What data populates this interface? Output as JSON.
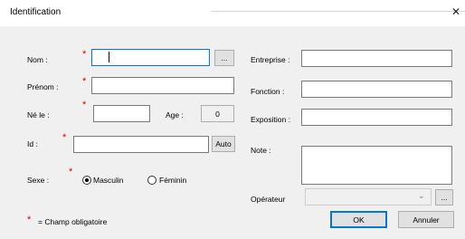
{
  "window": {
    "title": "Identification",
    "close_glyph": "✕"
  },
  "form": {
    "nom": {
      "label": "Nom :",
      "required_mark": "*",
      "value": "",
      "browse_label": "..."
    },
    "prenom": {
      "label": "Prénom :",
      "required_mark": "*",
      "value": ""
    },
    "ne_le": {
      "label": "Né le :",
      "required_mark": "*",
      "value": ""
    },
    "age": {
      "label": "Age :",
      "value": "0"
    },
    "id": {
      "label": "Id :",
      "required_mark": "*",
      "value": "",
      "auto_label": "Auto"
    },
    "sexe": {
      "label": "Sexe :",
      "required_mark": "*",
      "options": [
        "Masculin",
        "Féminin"
      ],
      "selected": "Masculin"
    },
    "entreprise": {
      "label": "Entreprise :",
      "value": ""
    },
    "fonction": {
      "label": "Fonction :",
      "value": ""
    },
    "exposition": {
      "label": "Exposition :",
      "value": ""
    },
    "note": {
      "label": "Note :",
      "value": ""
    },
    "operateur": {
      "label": "Opérateur",
      "value": "",
      "browse_label": "..."
    }
  },
  "footer": {
    "legend_mark": "*",
    "legend_text": "= Champ obligatoire",
    "ok_label": "OK",
    "cancel_label": "Annuler"
  },
  "colors": {
    "required": "#e00000",
    "focus": "#0078d7",
    "panel": "#f0f0f0"
  }
}
